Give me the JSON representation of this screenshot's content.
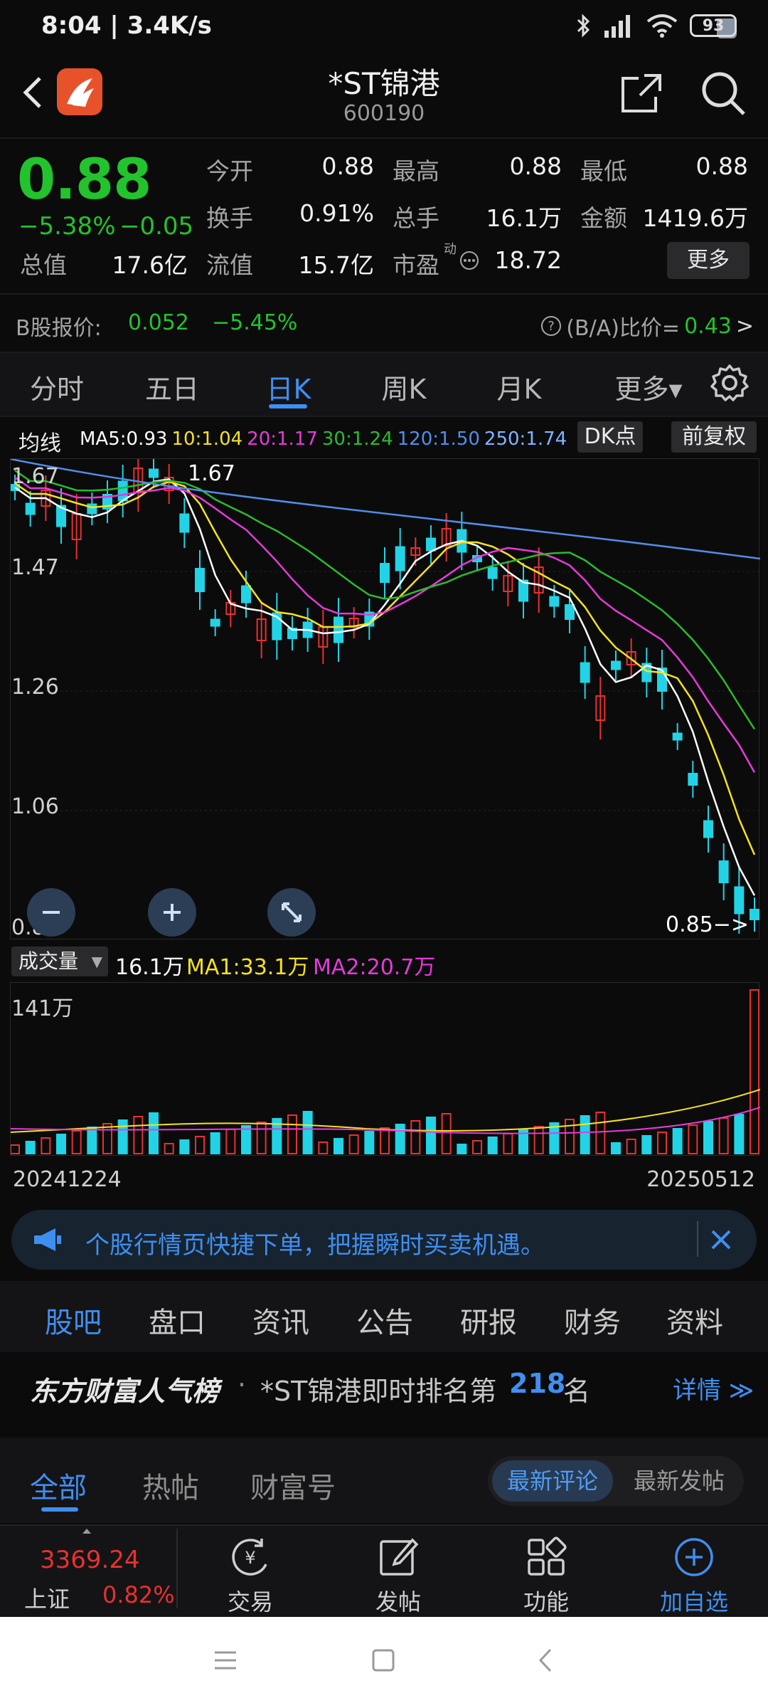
{
  "status": {
    "time": "8:04 | 3.4K/s",
    "battery": "93"
  },
  "header": {
    "title": "*ST锦港",
    "code": "600190"
  },
  "quote": {
    "price": "0.88",
    "change_pct": "−5.38%",
    "change": "−0.05",
    "fields": {
      "open": {
        "label": "今开",
        "value": "0.88"
      },
      "high": {
        "label": "最高",
        "value": "0.88"
      },
      "low": {
        "label": "最低",
        "value": "0.88"
      },
      "turnover": {
        "label": "换手",
        "value": "0.91%"
      },
      "volume": {
        "label": "总手",
        "value": "16.1万"
      },
      "amount": {
        "label": "金额",
        "value": "1419.6万"
      },
      "mcap": {
        "label": "总值",
        "value": "17.6亿"
      },
      "float": {
        "label": "流值",
        "value": "15.7亿"
      },
      "pe": {
        "label": "市盈",
        "sup": "动",
        "value": "18.72"
      }
    },
    "more_label": "更多"
  },
  "bshare": {
    "label": "B股报价:",
    "price": "0.052",
    "change": "−5.45%",
    "ratio_label": "(B/A)比价=",
    "ratio": "0.43",
    "arrow": ">"
  },
  "period_tabs": [
    "分时",
    "五日",
    "日K",
    "周K",
    "月K",
    "更多▾"
  ],
  "ma_legend": {
    "title": "均线",
    "items": [
      {
        "text": "MA5:0.93",
        "color": "#ffffff"
      },
      {
        "text": "10:1.04",
        "color": "#f5e31b"
      },
      {
        "text": "20:1.17",
        "color": "#e63ad9"
      },
      {
        "text": "30:1.24",
        "color": "#2bbb2b"
      },
      {
        "text": "120:1.50",
        "color": "#4f8ee8"
      },
      {
        "text": "250:1.74",
        "color": "#7fb4ff"
      }
    ],
    "dk_label": "DK点",
    "adj_label": "前复权"
  },
  "chart": {
    "y_labels": [
      "1.67",
      "1.47",
      "1.26",
      "1.06",
      "0.85"
    ],
    "high_marker": "1.67",
    "last_marker": "0.85−>"
  },
  "volume": {
    "selector": "成交量",
    "value": "16.1万",
    "ma1": "MA1:33.1万",
    "ma2": "MA2:20.7万",
    "max_label": "141万",
    "start_date": "20241224",
    "end_date": "20250512"
  },
  "banner": {
    "text": "个股行情页快捷下单，把握瞬时买卖机遇。"
  },
  "sub_tabs": [
    "股吧",
    "盘口",
    "资讯",
    "公告",
    "研报",
    "财务",
    "资料"
  ],
  "rank": {
    "logo": "东方财富人气榜",
    "dot": "·",
    "text": "*ST锦港即时排名第",
    "num": "218",
    "unit": "名",
    "detail": "详情 ≫"
  },
  "forum_tabs": [
    "全部",
    "热帖",
    "财富号"
  ],
  "forum_segments": [
    "最新评论",
    "最新发帖"
  ],
  "bottom_nav": {
    "index_value": "3369.24",
    "index_name": "上证",
    "index_change": "0.82%",
    "items": [
      "交易",
      "发帖",
      "功能",
      "加自选"
    ]
  },
  "colors": {
    "up": "#e8312f",
    "down": "#22c32c",
    "accent": "#3f8ff0",
    "candle_down": "#22d3e6"
  }
}
